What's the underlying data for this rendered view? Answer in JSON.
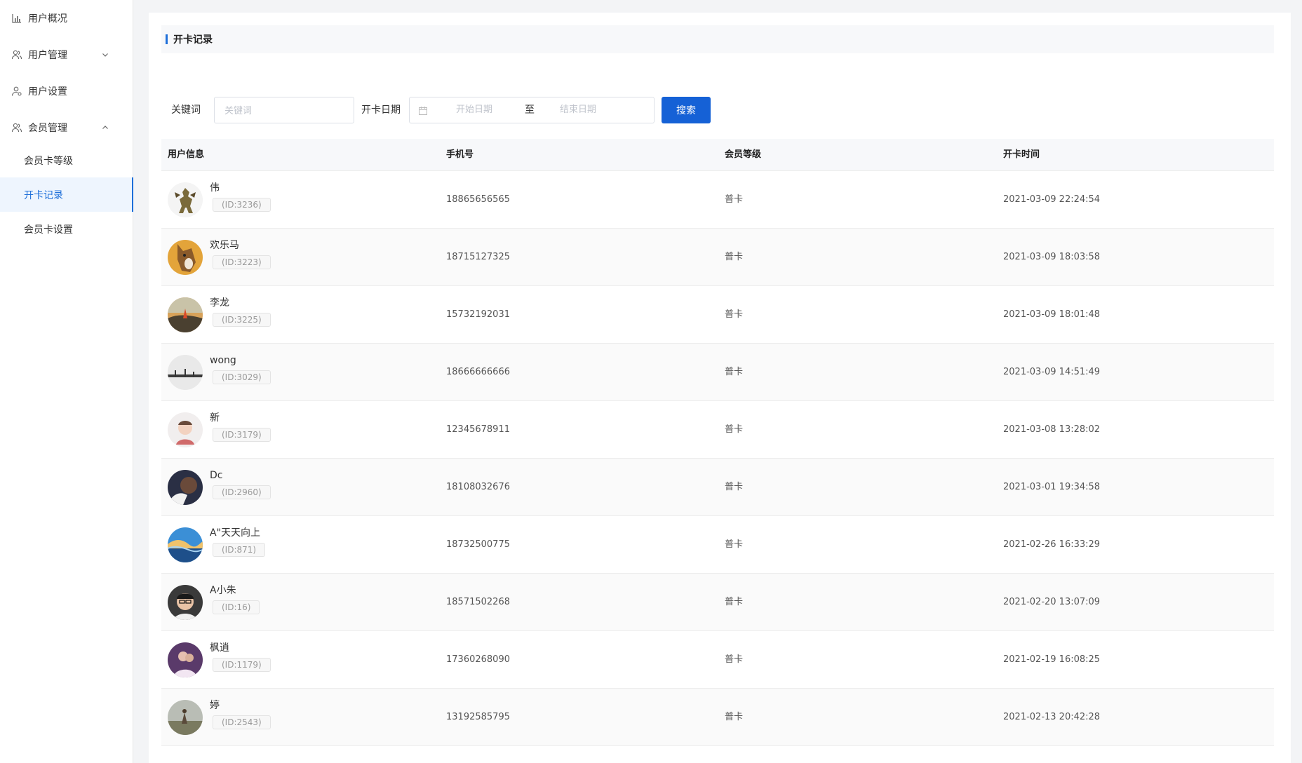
{
  "sidebar": {
    "items": [
      {
        "label": "用户概况",
        "icon": "bar-chart-icon"
      },
      {
        "label": "用户管理",
        "icon": "users-icon",
        "chevron": "down"
      },
      {
        "label": "用户设置",
        "icon": "user-settings-icon"
      },
      {
        "label": "会员管理",
        "icon": "member-icon",
        "chevron": "up"
      }
    ],
    "sub_items": [
      {
        "label": "会员卡等级",
        "active": false
      },
      {
        "label": "开卡记录",
        "active": true
      },
      {
        "label": "会员卡设置",
        "active": false
      }
    ]
  },
  "card": {
    "title": "开卡记录"
  },
  "filter": {
    "keyword_label": "关键词",
    "keyword_placeholder": "关键词",
    "date_label": "开卡日期",
    "start_placeholder": "开始日期",
    "separator": "至",
    "end_placeholder": "结束日期",
    "search_label": "搜索"
  },
  "table": {
    "headers": [
      "用户信息",
      "手机号",
      "会员等级",
      "开卡时间"
    ],
    "rows": [
      {
        "name": "伟",
        "id": "(ID:3236)",
        "phone": "18865656565",
        "level": "普卡",
        "time": "2021-03-09 22:24:54"
      },
      {
        "name": "欢乐马",
        "id": "(ID:3223)",
        "phone": "18715127325",
        "level": "普卡",
        "time": "2021-03-09 18:03:58"
      },
      {
        "name": "李龙",
        "id": "(ID:3225)",
        "phone": "15732192031",
        "level": "普卡",
        "time": "2021-03-09 18:01:48"
      },
      {
        "name": "wong",
        "id": "(ID:3029)",
        "phone": "18666666666",
        "level": "普卡",
        "time": "2021-03-09 14:51:49"
      },
      {
        "name": "新",
        "id": "(ID:3179)",
        "phone": "12345678911",
        "level": "普卡",
        "time": "2021-03-08 13:28:02"
      },
      {
        "name": "Dc",
        "id": "(ID:2960)",
        "phone": "18108032676",
        "level": "普卡",
        "time": "2021-03-01 19:34:58"
      },
      {
        "name": "A\"天天向上",
        "id": "(ID:871)",
        "phone": "18732500775",
        "level": "普卡",
        "time": "2021-02-26 16:33:29"
      },
      {
        "name": "A小朱",
        "id": "(ID:16)",
        "phone": "18571502268",
        "level": "普卡",
        "time": "2021-02-20 13:07:09"
      },
      {
        "name": "枫逍",
        "id": "(ID:1179)",
        "phone": "17360268090",
        "level": "普卡",
        "time": "2021-02-19 16:08:25"
      },
      {
        "name": "婷",
        "id": "(ID:2543)",
        "phone": "13192585795",
        "level": "普卡",
        "time": "2021-02-13 20:42:28"
      }
    ]
  },
  "colors": {
    "accent": "#1e6fd9",
    "button": "#1561d6",
    "active_bg": "#eef5fe"
  }
}
